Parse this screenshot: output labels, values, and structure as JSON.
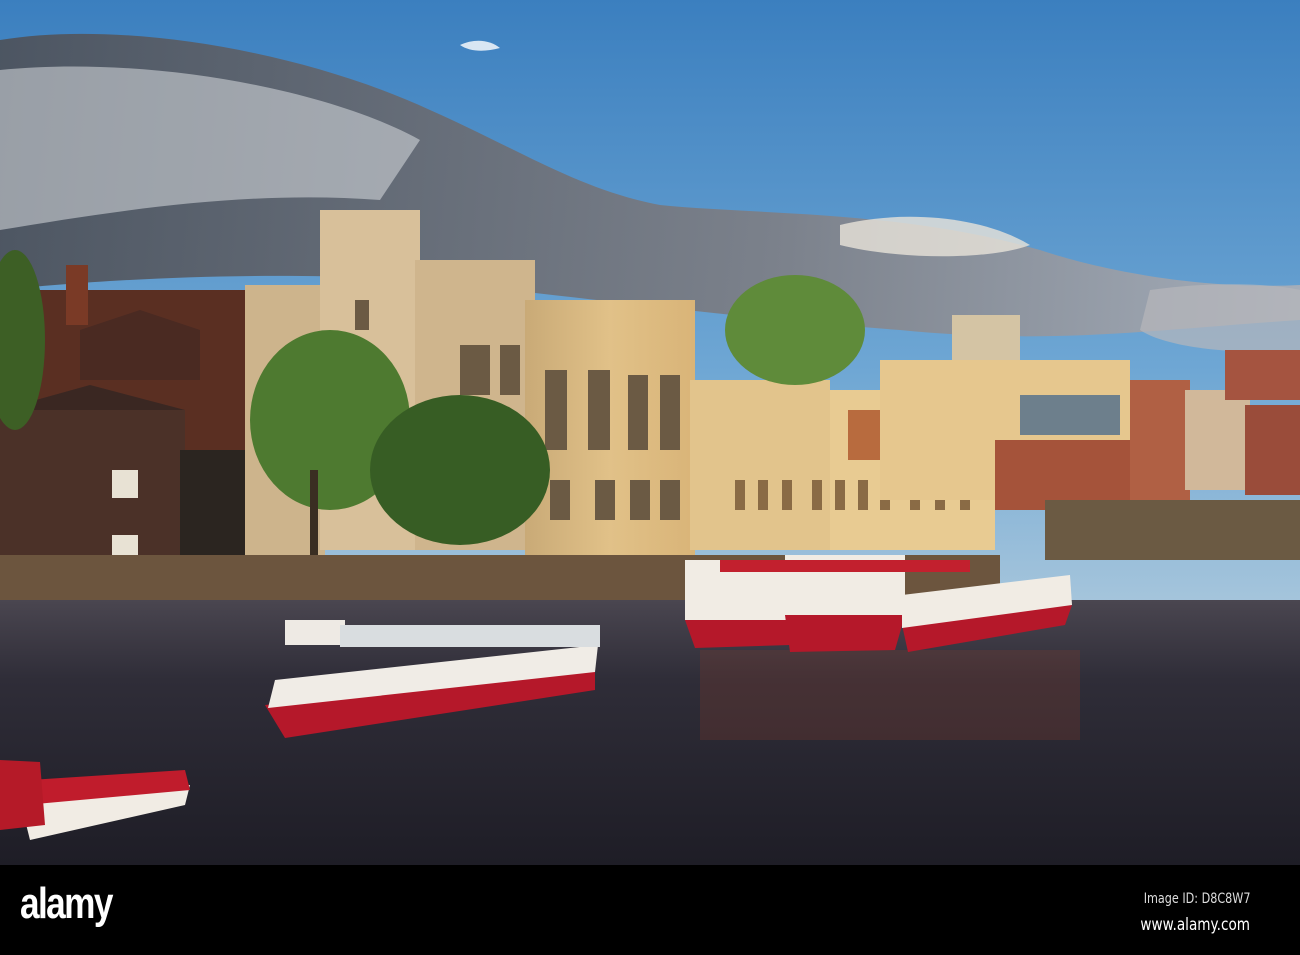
{
  "photo": {
    "subject": "River Ouse, York — riverside Guildhall buildings with red and white tour boats moored at sunset",
    "colors": {
      "sky": "#3f86c4",
      "cloud": "#6b7079",
      "stone": "#d9b676",
      "brick": "#6a3523",
      "water": "#2b2a33",
      "boat_red": "#b5182a"
    }
  },
  "watermark": {
    "text": "alamy"
  },
  "footer": {
    "logo": "alamy",
    "image_id": "Image ID: D8C8W7",
    "url": "www.alamy.com"
  }
}
